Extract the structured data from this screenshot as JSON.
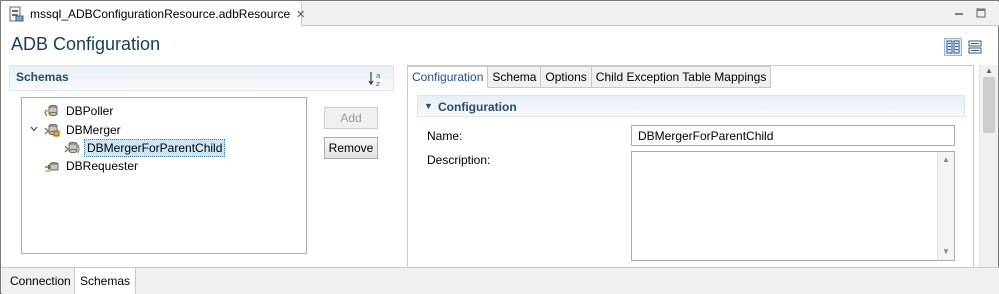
{
  "editor_tab": {
    "label": "mssql_ADBConfigurationResource.adbResource",
    "close_glyph": "✕",
    "file_icon": "adb-resource-file-icon"
  },
  "window_controls": {
    "minimize_glyph": "—",
    "maximize_glyph": "☐"
  },
  "page": {
    "title": "ADB Configuration"
  },
  "layout_buttons": [
    "horizontal-layout-icon",
    "vertical-layout-icon"
  ],
  "schemas_panel": {
    "title": "Schemas",
    "sort_icon": "sort-alpha-icon",
    "tree": [
      {
        "label": "DBPoller",
        "icon": "db-poller-icon",
        "expanded": null,
        "level": 0,
        "selected": false
      },
      {
        "label": "DBMerger",
        "icon": "db-merger-icon",
        "expanded": true,
        "level": 0,
        "selected": false
      },
      {
        "label": "DBMergerForParentChild",
        "icon": "db-merger-child-icon",
        "expanded": null,
        "level": 1,
        "selected": true
      },
      {
        "label": "DBRequester",
        "icon": "db-requester-icon",
        "expanded": null,
        "level": 0,
        "selected": false
      }
    ],
    "add_label": "Add",
    "remove_label": "Remove"
  },
  "right_panel": {
    "tabs": [
      "Configuration",
      "Schema",
      "Options",
      "Child Exception Table Mappings"
    ],
    "active_tab": "Configuration",
    "section_title": "Configuration",
    "name_label": "Name:",
    "name_value": "DBMergerForParentChild",
    "description_label": "Description:",
    "description_value": ""
  },
  "bottom_tabs": [
    "Connection",
    "Schemas"
  ],
  "active_bottom_tab": "Schemas",
  "colors": {
    "title": "#1a3c5a",
    "active_tab_text": "#1f4f9e",
    "selection_bg": "#cde6f7",
    "section_header": "#e7eef6"
  }
}
